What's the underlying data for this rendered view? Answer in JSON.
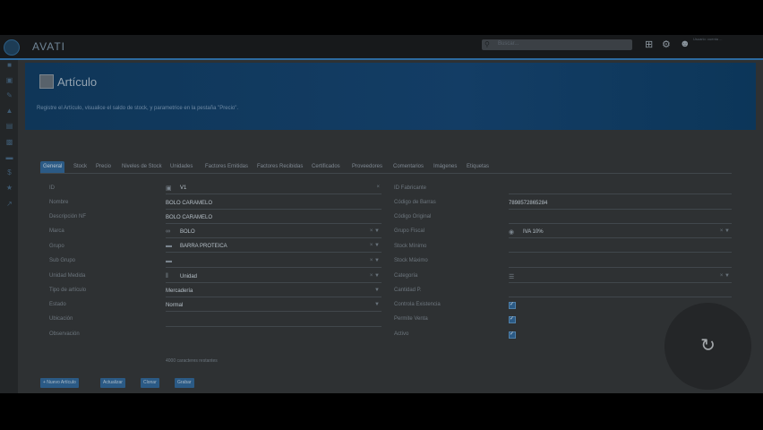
{
  "app": {
    "logo_text": "AVATI",
    "search_placeholder": "Buscar...",
    "user_info": "Usuario: cuenta ...",
    "header_icons": [
      "grid-icon",
      "gear-icon",
      "user-icon"
    ]
  },
  "sidebar": {
    "icons": [
      "home-icon",
      "cart-icon",
      "wrench-icon",
      "truck-icon",
      "money-icon",
      "factory-icon",
      "folder-icon",
      "dollar-icon",
      "star-icon",
      "chart-icon"
    ]
  },
  "page": {
    "title": "Artículo",
    "subtitle": "Registre el Artículo, visualice el saldo de stock, y parametrice en la pestaña \"Precio\"."
  },
  "tabs": [
    {
      "label": "General"
    },
    {
      "label": "Stock"
    },
    {
      "label": "Precio"
    },
    {
      "label": "Niveles de Stock"
    },
    {
      "label": "Unidades"
    },
    {
      "label": "Factores Emitidas"
    },
    {
      "label": "Factores Recibidas"
    },
    {
      "label": "Certificados"
    },
    {
      "label": "Proveedores"
    },
    {
      "label": "Comentarios"
    },
    {
      "label": "Imágenes"
    },
    {
      "label": "Etiquetas"
    }
  ],
  "left_labels": {
    "id": "ID",
    "nombre": "Nombre",
    "descripcion": "Descripción NF",
    "marca": "Marca",
    "grupo": "Grupo",
    "sub_grupo": "Sub Grupo",
    "unidad": "Unidad Medida",
    "tipo": "Tipo de artículo",
    "estado": "Estado",
    "ubicacion": "Ubicación",
    "observacion": "Observación"
  },
  "left_values": {
    "id": "V1",
    "nombre": "BOLO CARAMELO",
    "descripcion": "BOLO CARAMELO",
    "marca": "BOLO",
    "grupo": "BARRA PROTEICA",
    "unidad": "Unidad",
    "tipo": "Mercadería",
    "estado": "Normal",
    "chars_remaining": "4000 caracteres restantes"
  },
  "right_labels": {
    "id_fabricante": "ID Fabricante",
    "codigo_barras": "Código de Barras",
    "codigo_original": "Código Original",
    "grupo_fiscal": "Grupo Fiscal",
    "stock_minimo": "Stock Mínimo",
    "stock_maximo": "Stock Máximo",
    "categoria": "Categoría",
    "cantidad": "Cantidad P.",
    "controla_existencia": "Controla Existencia",
    "permite_venta": "Permite Venta",
    "activo": "Activo"
  },
  "right_values": {
    "codigo_barras": "7898572865284",
    "grupo_fiscal": "IVA 10%"
  },
  "checkboxes": {
    "controla_existencia": true,
    "permite_venta": true,
    "activo": true
  },
  "buttons": {
    "nuevo": "+ Nuevo Artículo",
    "actualizar": "Actualizar",
    "clonar": "Clonar",
    "grabar": "Grabar"
  },
  "colors": {
    "accent": "#2b5a85",
    "hero": "#133d65",
    "topbar_line": "#2c6aa0"
  }
}
